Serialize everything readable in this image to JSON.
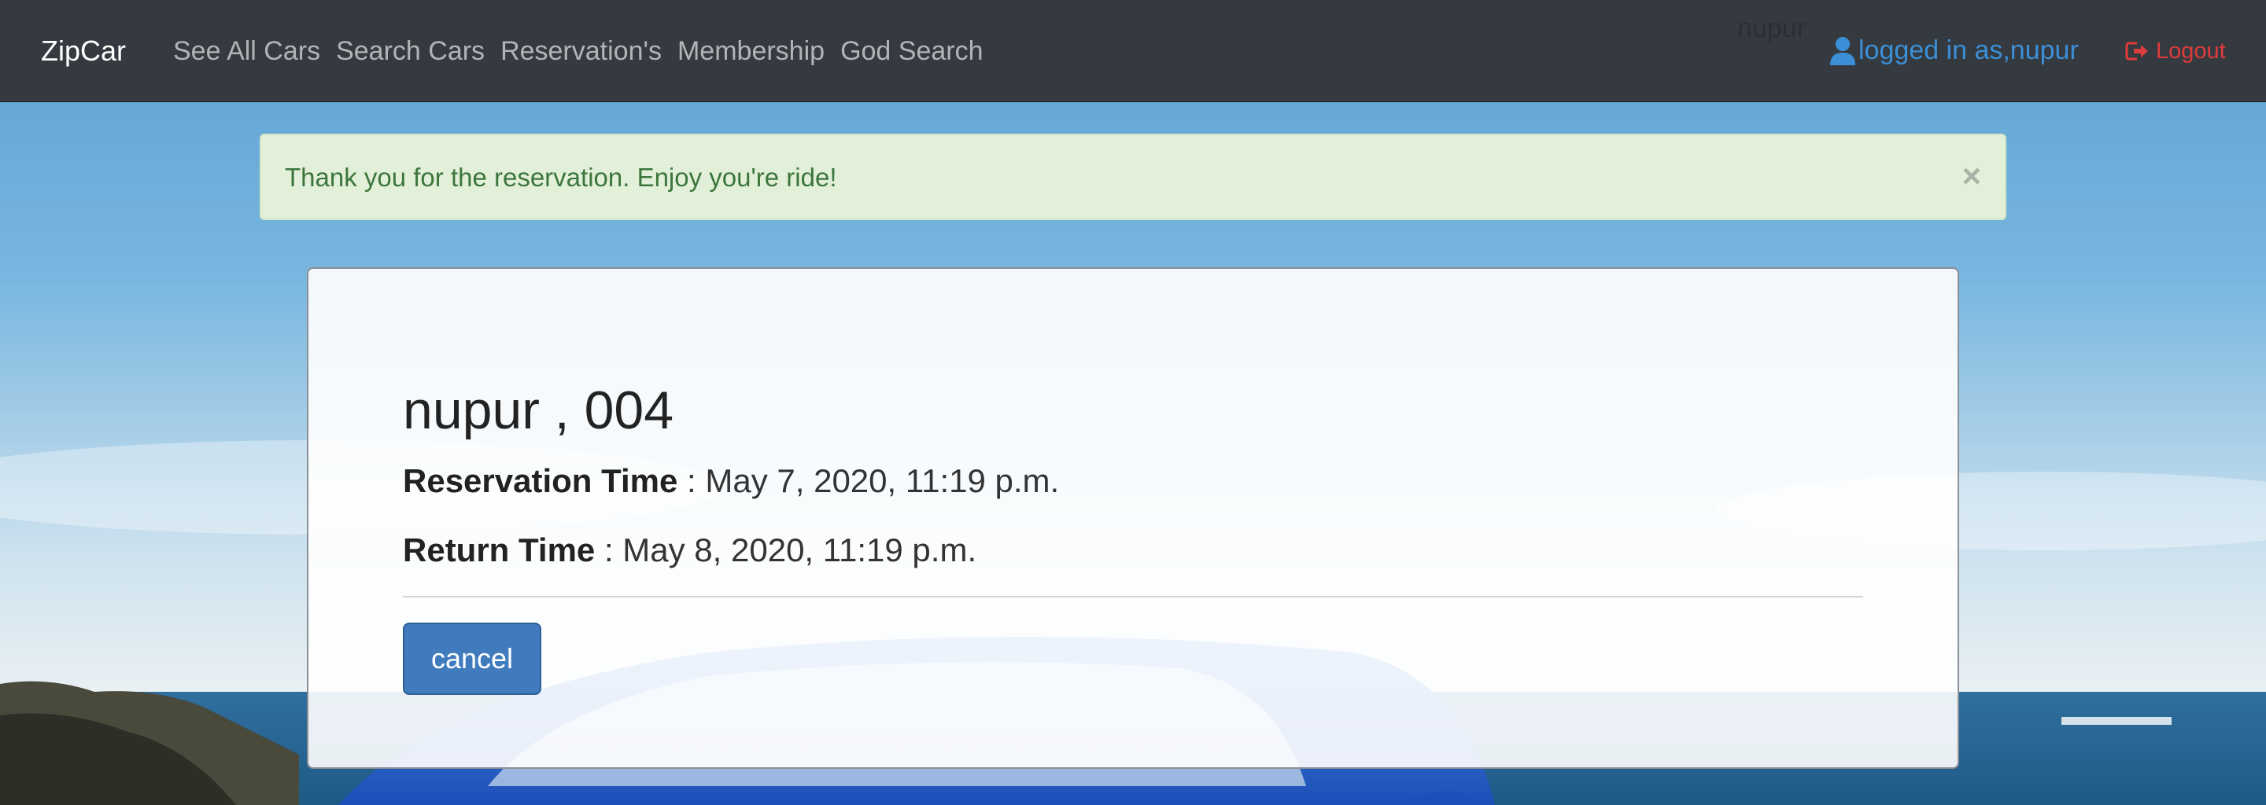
{
  "navbar": {
    "brand": "ZipCar",
    "links": [
      "See All Cars",
      "Search Cars",
      "Reservation's",
      "Membership",
      "God Search"
    ],
    "ghost_text": "nupur",
    "user_label": "logged in as,nupur",
    "logout_label": "Logout"
  },
  "alert": {
    "message": "Thank you for the reservation. Enjoy you're ride!",
    "close": "×"
  },
  "reservation": {
    "title": "nupur , 004",
    "reservation_time_label": "Reservation Time",
    "reservation_time_value": " : May 7, 2020, 11:19 p.m.",
    "return_time_label": "Return Time",
    "return_time_value": " : May 8, 2020, 11:19 p.m.",
    "cancel_label": "cancel"
  },
  "colors": {
    "navbar_bg": "#343a40",
    "alert_bg": "#e3f0d9",
    "alert_text": "#3c763d",
    "user_link": "#3c8fd6",
    "logout": "#e03b3b",
    "button": "#3f7bbd"
  },
  "icons": {
    "user": "user-icon",
    "logout": "logout-icon"
  }
}
